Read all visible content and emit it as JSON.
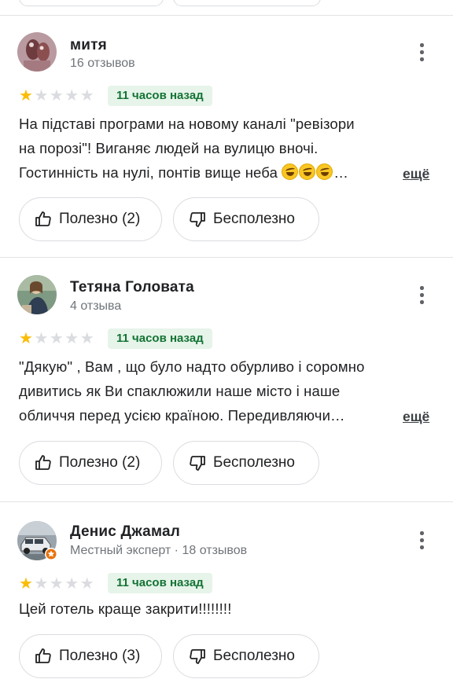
{
  "reviews": [
    {
      "author": "митя",
      "subtitle": "16 отзывов",
      "rating": 1,
      "max_rating": 5,
      "time": "11 часов назад",
      "text_lines": [
        "На підставі програми на новому каналі \"ревізори",
        "на порозі\"! Виганяє людей на вулицю вночі.",
        "Гостинність на нулі, понтів вище неба"
      ],
      "text_emoji": "🤣🤣🤣",
      "text_ellipsis": "…",
      "more": "ещё",
      "helpful": "Полезно (2)",
      "unhelpful": "Бесполезно"
    },
    {
      "author": "Тетяна Головата",
      "subtitle": "4 отзыва",
      "rating": 1,
      "max_rating": 5,
      "time": "11 часов назад",
      "text_lines": [
        "\"Дякую\" , Вам , що було надто обурливо і соромно",
        "дивитись як Ви спаклюжили наше місто і наше",
        "обличчя перед усією країною. Передивляючи…"
      ],
      "more": "ещё",
      "helpful": "Полезно (2)",
      "unhelpful": "Бесполезно"
    },
    {
      "author": "Денис Джамал",
      "subtitle": "Местный эксперт · 18 отзывов",
      "rating": 1,
      "max_rating": 5,
      "time": "11 часов назад",
      "text_lines": [
        "Цей готель краще закрити!!!!!!!!"
      ],
      "helpful": "Полезно (3)",
      "unhelpful": "Бесполезно"
    }
  ],
  "colors": {
    "star_on": "#fbbc04",
    "star_off": "#dadce0",
    "time_badge_bg": "#e6f4ea",
    "time_badge_text": "#137333",
    "divider": "#e3e3e3"
  },
  "icons": {
    "menu": "more-vert-icon",
    "helpful": "thumb-up-icon",
    "unhelpful": "thumb-down-icon",
    "local_guide": "local-guide-badge-icon"
  }
}
